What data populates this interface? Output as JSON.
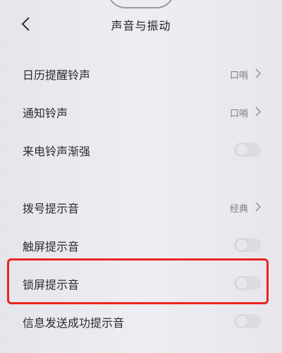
{
  "header": {
    "title": "声音与振动",
    "back_icon": "chevron-left-icon"
  },
  "settings": [
    {
      "label": "日历提醒铃声",
      "value": "口哨",
      "control": "link"
    },
    {
      "label": "通知铃声",
      "value": "口哨",
      "control": "link"
    },
    {
      "label": "来电铃声渐强",
      "control": "toggle",
      "on": false
    },
    {
      "label": "拨号提示音",
      "value": "经典",
      "control": "link"
    },
    {
      "label": "触屏提示音",
      "control": "toggle",
      "on": false
    },
    {
      "label": "锁屏提示音",
      "control": "toggle",
      "on": false
    },
    {
      "label": "信息发送成功提示音",
      "control": "toggle",
      "on": false
    }
  ],
  "colors": {
    "highlight": "#e8261f",
    "background": "#e9e8ee"
  }
}
